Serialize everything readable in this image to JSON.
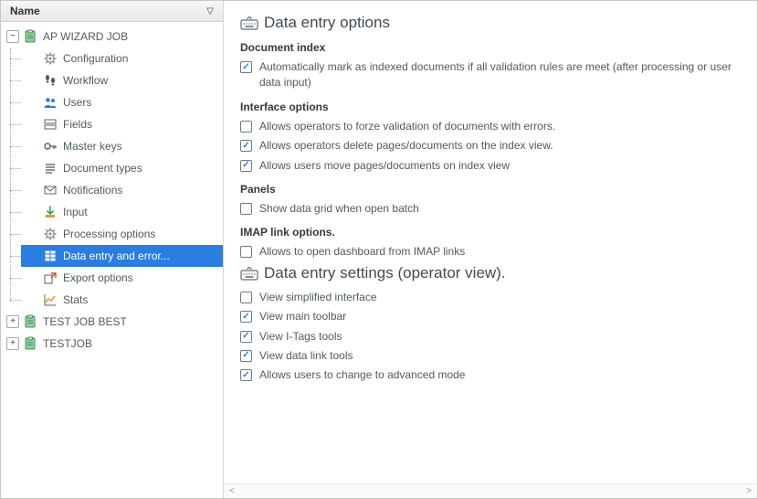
{
  "tree": {
    "header": "Name",
    "root": [
      {
        "label": "AP WIZARD JOB",
        "icon": "clipboard",
        "expanded": true,
        "children": [
          {
            "label": "Configuration",
            "icon": "gear"
          },
          {
            "label": "Workflow",
            "icon": "footsteps"
          },
          {
            "label": "Users",
            "icon": "users"
          },
          {
            "label": "Fields",
            "icon": "fields"
          },
          {
            "label": "Master keys",
            "icon": "key"
          },
          {
            "label": "Document types",
            "icon": "lines"
          },
          {
            "label": "Notifications",
            "icon": "envelope"
          },
          {
            "label": "Input",
            "icon": "download"
          },
          {
            "label": "Processing options",
            "icon": "gear2"
          },
          {
            "label": "Data entry and error...",
            "icon": "table",
            "selected": true
          },
          {
            "label": "Export options",
            "icon": "export"
          },
          {
            "label": "Stats",
            "icon": "chart"
          }
        ]
      },
      {
        "label": "TEST JOB BEST",
        "icon": "clipboard",
        "expanded": false,
        "children": []
      },
      {
        "label": "TESTJOB",
        "icon": "clipboard",
        "expanded": false,
        "children": []
      }
    ]
  },
  "panel": {
    "title1": "Data entry options",
    "groups1": [
      {
        "heading": "Document index",
        "items": [
          {
            "checked": true,
            "text": "Automatically mark as indexed documents if all validation rules are meet (after processing or user data input)"
          }
        ]
      },
      {
        "heading": "Interface options",
        "items": [
          {
            "checked": false,
            "text": "Allows operators to forze validation of documents with errors."
          },
          {
            "checked": true,
            "text": "Allows operators delete pages/documents on the index view."
          },
          {
            "checked": true,
            "text": "Allows users move pages/documents on index view"
          }
        ]
      },
      {
        "heading": "Panels",
        "items": [
          {
            "checked": false,
            "text": "Show data grid when open batch"
          }
        ]
      },
      {
        "heading": "IMAP link options.",
        "items": [
          {
            "checked": false,
            "text": "Allows to open dashboard from IMAP links"
          }
        ]
      }
    ],
    "title2": "Data entry settings (operator view).",
    "items2": [
      {
        "checked": false,
        "text": "View simplified interface"
      },
      {
        "checked": true,
        "text": "View main toolbar"
      },
      {
        "checked": true,
        "text": "View I-Tags tools"
      },
      {
        "checked": true,
        "text": "View data link tools"
      },
      {
        "checked": true,
        "text": "Allows users to change to advanced mode"
      }
    ]
  }
}
